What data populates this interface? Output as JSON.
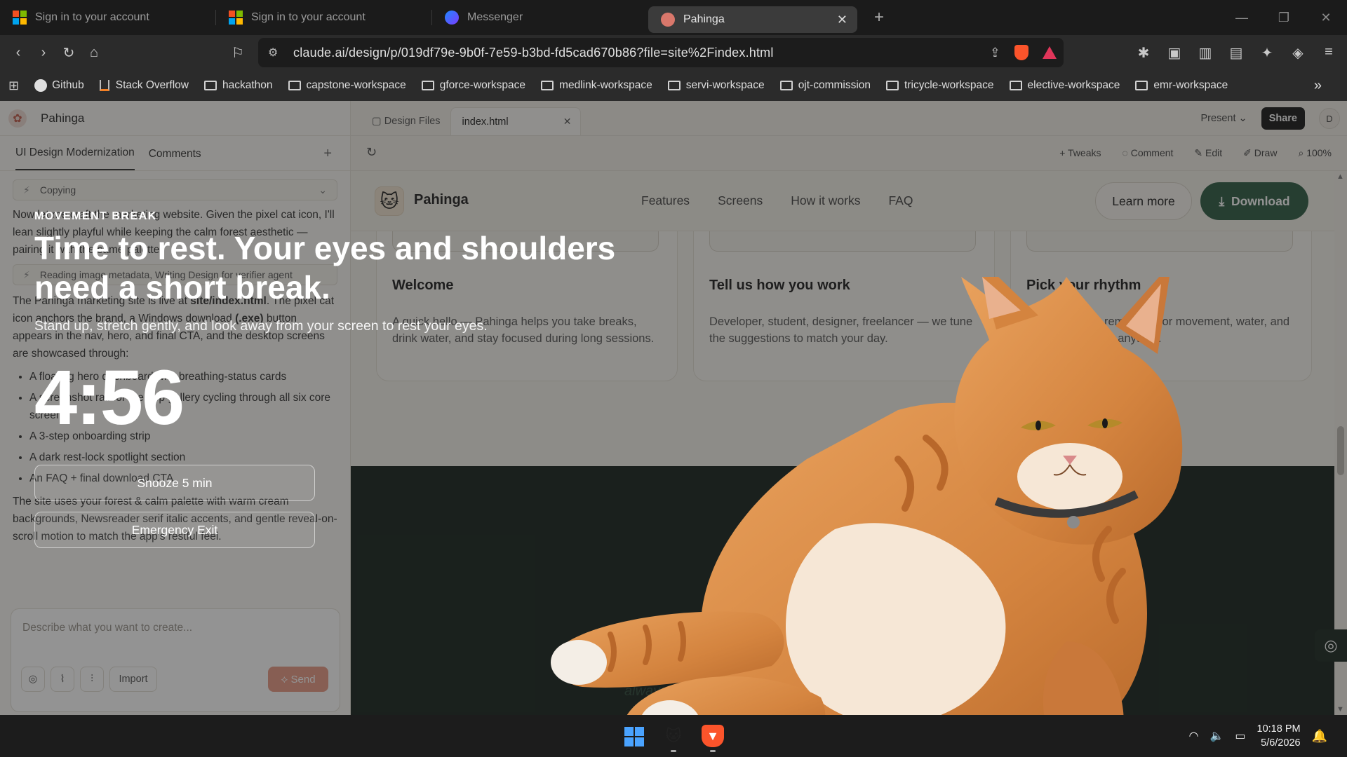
{
  "browser": {
    "tabs": [
      {
        "title": "Sign in to your account",
        "icon": "microsoft-icon"
      },
      {
        "title": "Sign in to your account",
        "icon": "microsoft-icon"
      },
      {
        "title": "Messenger",
        "icon": "messenger-icon"
      },
      {
        "title": "Pahinga",
        "icon": "pahinga-icon",
        "active": true
      }
    ],
    "url": "claude.ai/design/p/019df79e-9b0f-7e59-b3bd-fd5cad670b86?file=site%2Findex.html",
    "bookmarks": [
      "Github",
      "Stack Overflow",
      "hackathon",
      "capstone-workspace",
      "gforce-workspace",
      "medlink-workspace",
      "servi-workspace",
      "ojt-commission",
      "tricycle-workspace",
      "elective-workspace",
      "emr-workspace"
    ]
  },
  "left_panel": {
    "project_name": "Pahinga",
    "tabs": [
      "UI Design Modernization",
      "Comments"
    ],
    "tool_row_1": "Copying",
    "tool_row_2": "Reading image metadata, Writing Design for verifier agent",
    "para_1": "Now let me craft the marketing website. Given the pixel cat icon, I'll lean slightly playful while keeping the calm forest aesthetic — pairing it with the same palette.",
    "para_2_pre": "The Pahinga marketing site is live at ",
    "para_2_link": "site/index.html",
    "para_2_post": ". The pixel cat icon anchors the brand, a Windows download ",
    "para_2_bold": "(.exe)",
    "para_2_end": " button appears in the nav, hero, and final CTA, and the desktop screens are showcased through:",
    "bullets": [
      "A floating hero dashboard with breathing-status cards",
      "A screenshot rail for the app gallery cycling through all six core screens",
      "A 3-step onboarding strip",
      "A dark rest-lock spotlight section",
      "An FAQ + final download CTA"
    ],
    "para_3": "The site uses your forest & calm palette with warm cream backgrounds, Newsreader serif italic accents, and gentle reveal-on-scroll motion to match the app's restful feel.",
    "composer_placeholder": "Describe what you want to create...",
    "import_label": "Import",
    "send_label": "Send"
  },
  "right_panel": {
    "file_tabs": [
      "Design Files",
      "index.html"
    ],
    "present_label": "Present",
    "share_label": "Share",
    "avatar_initial": "D",
    "tools": [
      "Tweaks",
      "Comment",
      "Edit",
      "Draw",
      "100%"
    ]
  },
  "site": {
    "brand": "Pahinga",
    "nav_links": [
      "Features",
      "Screens",
      "How it works",
      "FAQ"
    ],
    "learn_more": "Learn more",
    "download": "Download",
    "cards": [
      {
        "title": "Welcome",
        "body": "A quick hello — Pahinga helps you take breaks, drink water, and stay focused during long sessions."
      },
      {
        "title": "Tell us how you work",
        "body": "Developer, student, designer, freelancer — we tune the suggestions to match your day."
      },
      {
        "title": "Pick your rhythm",
        "body": "Choose gentle reminders for movement, water, and eye rest. Change anytime."
      }
    ],
    "dark_tagline": "always-on"
  },
  "overlay": {
    "label": "MOVEMENT BREAK",
    "title": "Time to rest. Your eyes and shoulders need a short break.",
    "subtitle": "Stand up, stretch gently, and look away from your screen to rest your eyes.",
    "timer": "4:56",
    "snooze": "Snooze 5 min",
    "exit": "Emergency Exit"
  },
  "taskbar": {
    "time": "10:18 PM",
    "date": "5/6/2026"
  }
}
